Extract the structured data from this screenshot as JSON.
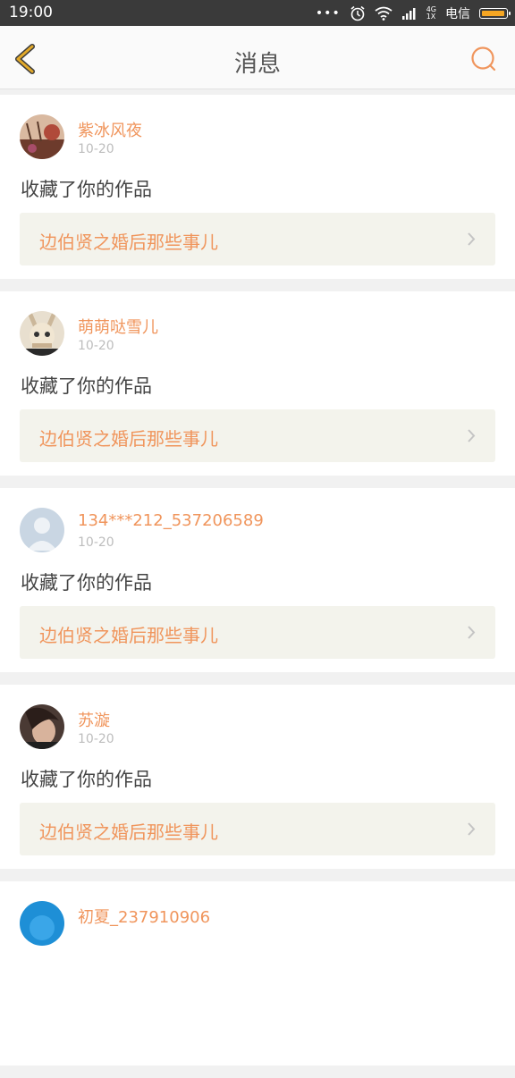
{
  "status_bar": {
    "time": "19:00",
    "network": "4G",
    "carrier": "电信",
    "battery_color": "#f5a623"
  },
  "header": {
    "title": "消息",
    "back_icon": "chevron-left-icon",
    "search_icon": "search-icon"
  },
  "colors": {
    "accent": "#f0955c",
    "back_arrow": "#e2a92a"
  },
  "notifications": [
    {
      "username": "紫冰风夜",
      "date": "10-20",
      "action": "收藏了你的作品",
      "work_title": "边伯贤之婚后那些事儿",
      "avatar": "photo-avatar"
    },
    {
      "username": "萌萌哒雪儿",
      "date": "10-20",
      "action": "收藏了你的作品",
      "work_title": "边伯贤之婚后那些事儿",
      "avatar": "photo-avatar"
    },
    {
      "username": "134***212_537206589",
      "date": "10-20",
      "action": "收藏了你的作品",
      "work_title": "边伯贤之婚后那些事儿",
      "avatar": "default-user-avatar"
    },
    {
      "username": "苏漩",
      "date": "10-20",
      "action": "收藏了你的作品",
      "work_title": "边伯贤之婚后那些事儿",
      "avatar": "photo-avatar"
    },
    {
      "username": "初夏_237910906",
      "date": "",
      "action": "",
      "work_title": "",
      "avatar": "blue-avatar"
    }
  ]
}
